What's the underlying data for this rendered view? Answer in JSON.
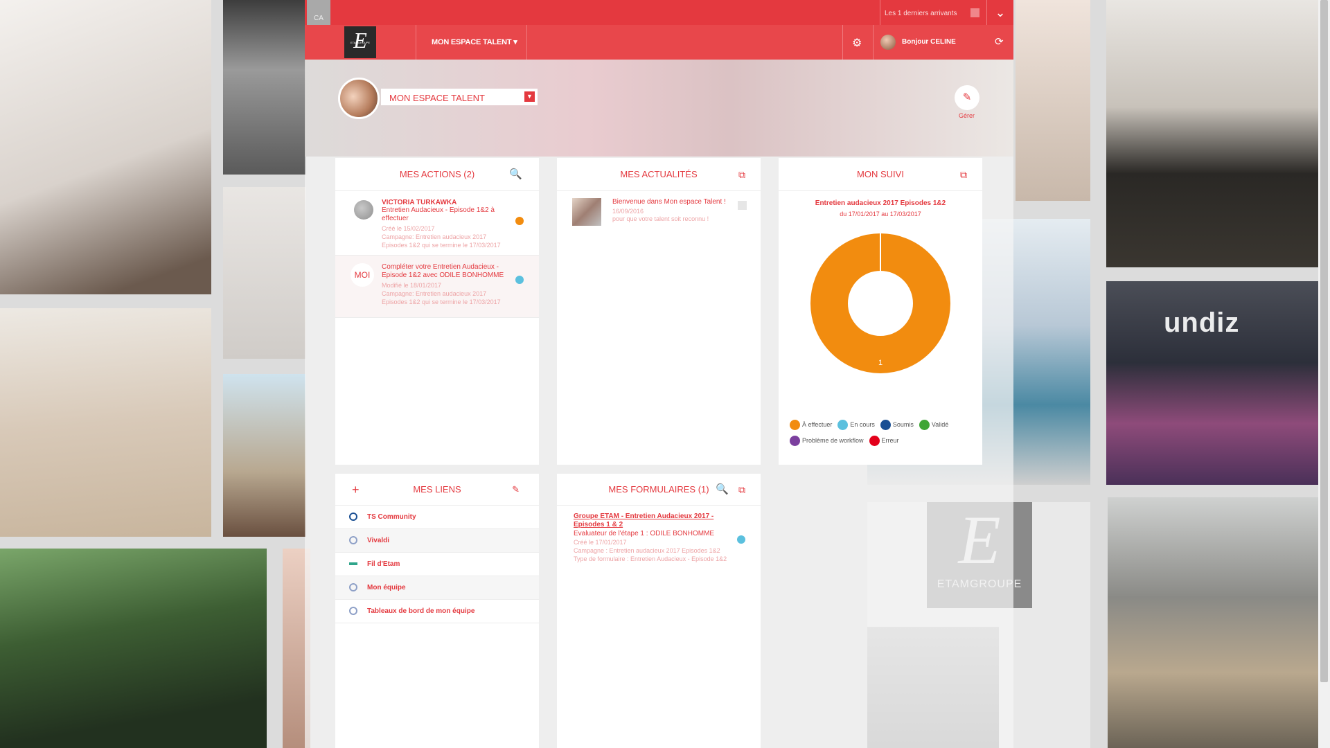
{
  "topbar": {
    "ca_label": "CA",
    "recent_label": "Les 1 derniers arrivants"
  },
  "nav": {
    "menu_label": "MON ESPACE TALENT",
    "greeting": "Bonjour CELINE"
  },
  "logo": {
    "mark": "E",
    "caption": "ETAMGROUPE"
  },
  "profile": {
    "space_label": "MON ESPACE TALENT",
    "manage_label": "Gérer"
  },
  "actions": {
    "title": "MES ACTIONS (2)",
    "items": [
      {
        "name": "VICTORIA TURKAWKA",
        "title": "Entretien Audacieux - Episode 1&2 à effectuer",
        "created": "Créé le 15/02/2017",
        "campaign": "Campagne: Entretien audacieux 2017 Episodes 1&2 qui se termine le 17/03/2017",
        "status_color": "#f28c0f"
      },
      {
        "badge": "MOI",
        "title": "Compléter votre Entretien Audacieux - Episode 1&2 avec ODILE BONHOMME",
        "modified": "Modifié le 18/01/2017",
        "campaign": "Campagne: Entretien audacieux 2017 Episodes 1&2 qui se termine le 17/03/2017",
        "status_color": "#5bc0de"
      }
    ]
  },
  "news": {
    "title": "MES ACTUALITÉS",
    "items": [
      {
        "title": "Bienvenue dans Mon espace Talent !",
        "date": "16/09/2016",
        "text": "pour que votre talent soit reconnu !"
      }
    ]
  },
  "suivi": {
    "title": "MON SUIVI",
    "campaign": "Entretien audacieux 2017 Episodes 1&2",
    "period": "du 17/01/2017 au 17/03/2017",
    "legend": [
      {
        "label": "À effectuer",
        "color": "#f28c0f"
      },
      {
        "label": "En cours",
        "color": "#5bc0de"
      },
      {
        "label": "Soumis",
        "color": "#1a4f93"
      },
      {
        "label": "Validé",
        "color": "#3fa535"
      },
      {
        "label": "Problème de workflow",
        "color": "#7b3f9e"
      },
      {
        "label": "Erreur",
        "color": "#e3001b"
      }
    ]
  },
  "chart_data": {
    "type": "pie",
    "categories": [
      "À effectuer",
      "En cours",
      "Soumis",
      "Validé",
      "Problème de workflow",
      "Erreur"
    ],
    "values": [
      1,
      0,
      0,
      0,
      0,
      0
    ],
    "data_labels": [
      "1"
    ],
    "legend_placement": "bottom"
  },
  "links": {
    "title": "MES LIENS",
    "items": [
      "TS Community",
      "Vivaldi",
      "Fil d'Etam",
      "Mon équipe",
      "Tableaux de bord de mon équipe"
    ]
  },
  "forms": {
    "title": "MES FORMULAIRES (1)",
    "items": [
      {
        "title": "Groupe ETAM - Entretien Audacieux 2017 - Episodes 1 & 2",
        "evaluator": "Evaluateur de l'étape 1 : ODILE BONHOMME",
        "created": "Créé le 17/01/2017",
        "campaign": "Campagne : Entretien audacieux 2017 Episodes 1&2",
        "type": "Type de formulaire : Entretien Audacieux - Episode 1&2",
        "status_color": "#5bc0de"
      }
    ]
  },
  "background": {
    "store_sign": "undiz",
    "brand_logo_text": "ETAMGROUPE"
  },
  "colors": {
    "accent": "#e4393f",
    "accent_light": "#eda3a5"
  }
}
